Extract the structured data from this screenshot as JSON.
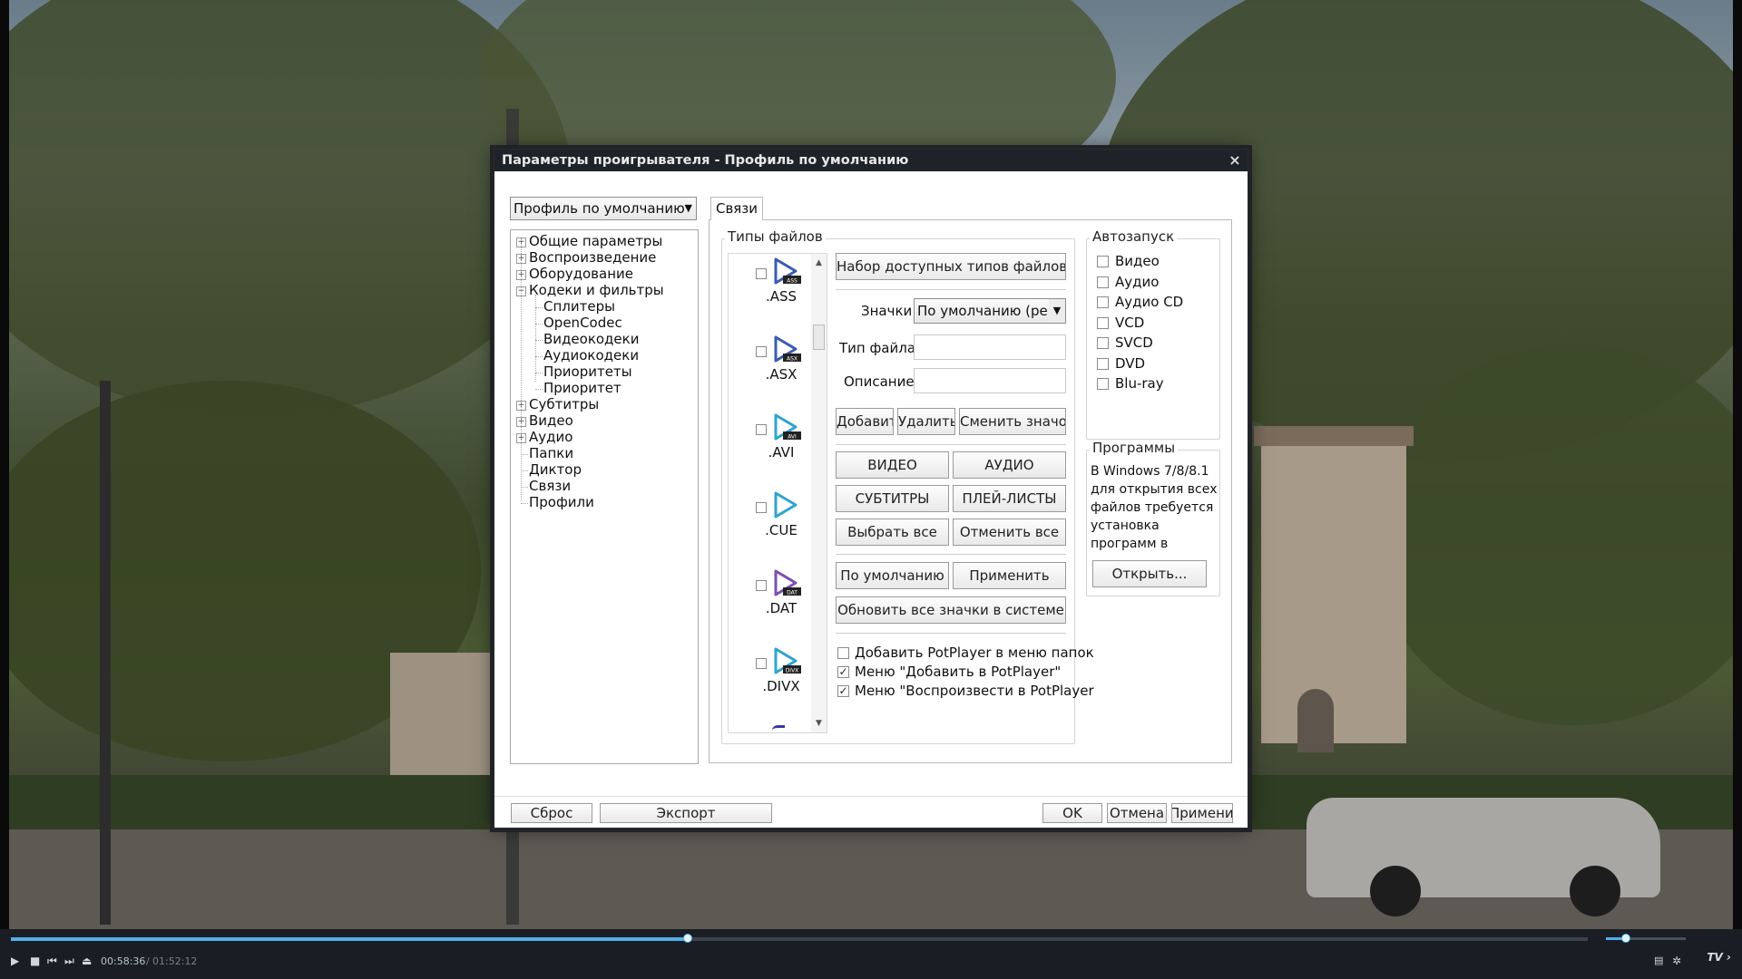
{
  "dialog": {
    "title": "Параметры проигрывателя - Профиль по умолчанию",
    "close_glyph": "×",
    "profile_select": "Профиль по умолчанию",
    "tab": "Связи"
  },
  "tree": {
    "items": [
      {
        "label": "Общие параметры",
        "expandable": true,
        "level": 0
      },
      {
        "label": "Воспроизведение",
        "expandable": true,
        "level": 0
      },
      {
        "label": "Оборудование",
        "expandable": true,
        "level": 0
      },
      {
        "label": "Кодеки и фильтры",
        "expandable": true,
        "expanded": true,
        "level": 0
      },
      {
        "label": "Сплитеры",
        "level": 1
      },
      {
        "label": "OpenCodec",
        "level": 1
      },
      {
        "label": "Видеокодеки",
        "level": 1
      },
      {
        "label": "Аудиокодеки",
        "level": 1
      },
      {
        "label": "Приоритеты",
        "level": 1
      },
      {
        "label": "Приоритет",
        "level": 1
      },
      {
        "label": "Субтитры",
        "expandable": true,
        "level": 0
      },
      {
        "label": "Видео",
        "expandable": true,
        "level": 0
      },
      {
        "label": "Аудио",
        "expandable": true,
        "level": 0
      },
      {
        "label": "Папки",
        "level": 0
      },
      {
        "label": "Диктор",
        "level": 0
      },
      {
        "label": "Связи",
        "level": 0
      },
      {
        "label": "Профили",
        "level": 0
      }
    ]
  },
  "file_types": {
    "group_title": "Типы файлов",
    "items": [
      {
        "ext": ".ASS",
        "badge": "ASS",
        "color": "#3a5bb5"
      },
      {
        "ext": ".ASX",
        "badge": "ASX",
        "color": "#3a5bb5"
      },
      {
        "ext": ".AVI",
        "badge": "AVI",
        "color": "#2ea3cf"
      },
      {
        "ext": ".CUE",
        "badge": "",
        "color": "#2ea3cf"
      },
      {
        "ext": ".DAT",
        "badge": "DAT",
        "color": "#7b4fb3"
      },
      {
        "ext": ".DIVX",
        "badge": "DIVX",
        "color": "#2ea3cf"
      }
    ],
    "scroll_up": "▲",
    "scroll_down": "▼",
    "available_types_button": "Набор доступных типов файлов...",
    "icons_label": "Значки:",
    "icons_value": "По умолчанию (рек",
    "file_type_label": "Тип файла:",
    "description_label": "Описание:",
    "add_button": "Добавить",
    "remove_button": "Удалить",
    "change_icon_button": "Сменить значок...",
    "video_button": "ВИДЕО",
    "audio_button": "АУДИО",
    "subtitles_button": "СУБТИТРЫ",
    "playlists_button": "ПЛЕЙ-ЛИСТЫ",
    "select_all_button": "Выбрать все",
    "deselect_all_button": "Отменить все",
    "default_button": "По умолчанию",
    "apply_button": "Применить",
    "refresh_icons_button": "Обновить все значки в системе",
    "options": [
      {
        "label": "Добавить PotPlayer в меню папок",
        "checked": false
      },
      {
        "label": "Меню \"Добавить в PotPlayer\"",
        "checked": true
      },
      {
        "label": "Меню \"Воспроизвести в PotPlayer",
        "checked": true
      }
    ]
  },
  "autorun": {
    "title": "Автозапуск",
    "items": [
      {
        "label": "Видео",
        "checked": false
      },
      {
        "label": "Аудио",
        "checked": false
      },
      {
        "label": "Аудио CD",
        "checked": false
      },
      {
        "label": "VCD",
        "checked": false
      },
      {
        "label": "SVCD",
        "checked": false
      },
      {
        "label": "DVD",
        "checked": false
      },
      {
        "label": "Blu-ray",
        "checked": false
      }
    ]
  },
  "programs": {
    "title": "Программы",
    "lines": [
      "В Windows 7/8/8.1",
      "для открытия всех",
      "файлов требуется",
      "установка",
      "программ в"
    ],
    "open_button": "Открыть..."
  },
  "footer": {
    "reset_button": "Сброс",
    "export_button": "Экспорт",
    "ok_button": "OK",
    "cancel_button": "Отмена",
    "apply_button": "Применит"
  },
  "player": {
    "time_current": "00:58:36",
    "time_separator": "/",
    "time_total": "01:52:12",
    "progress": 0.429,
    "volume": 0.25,
    "badge": "TV",
    "play_glyph": "▶",
    "stop_glyph": "■",
    "prev_glyph": "⏮",
    "next_glyph": "⏭",
    "eject_glyph": "⏏",
    "chevron_glyph": "›"
  },
  "colors": {
    "accent": "#4fb0e8",
    "titlebar": "#1e2329"
  }
}
